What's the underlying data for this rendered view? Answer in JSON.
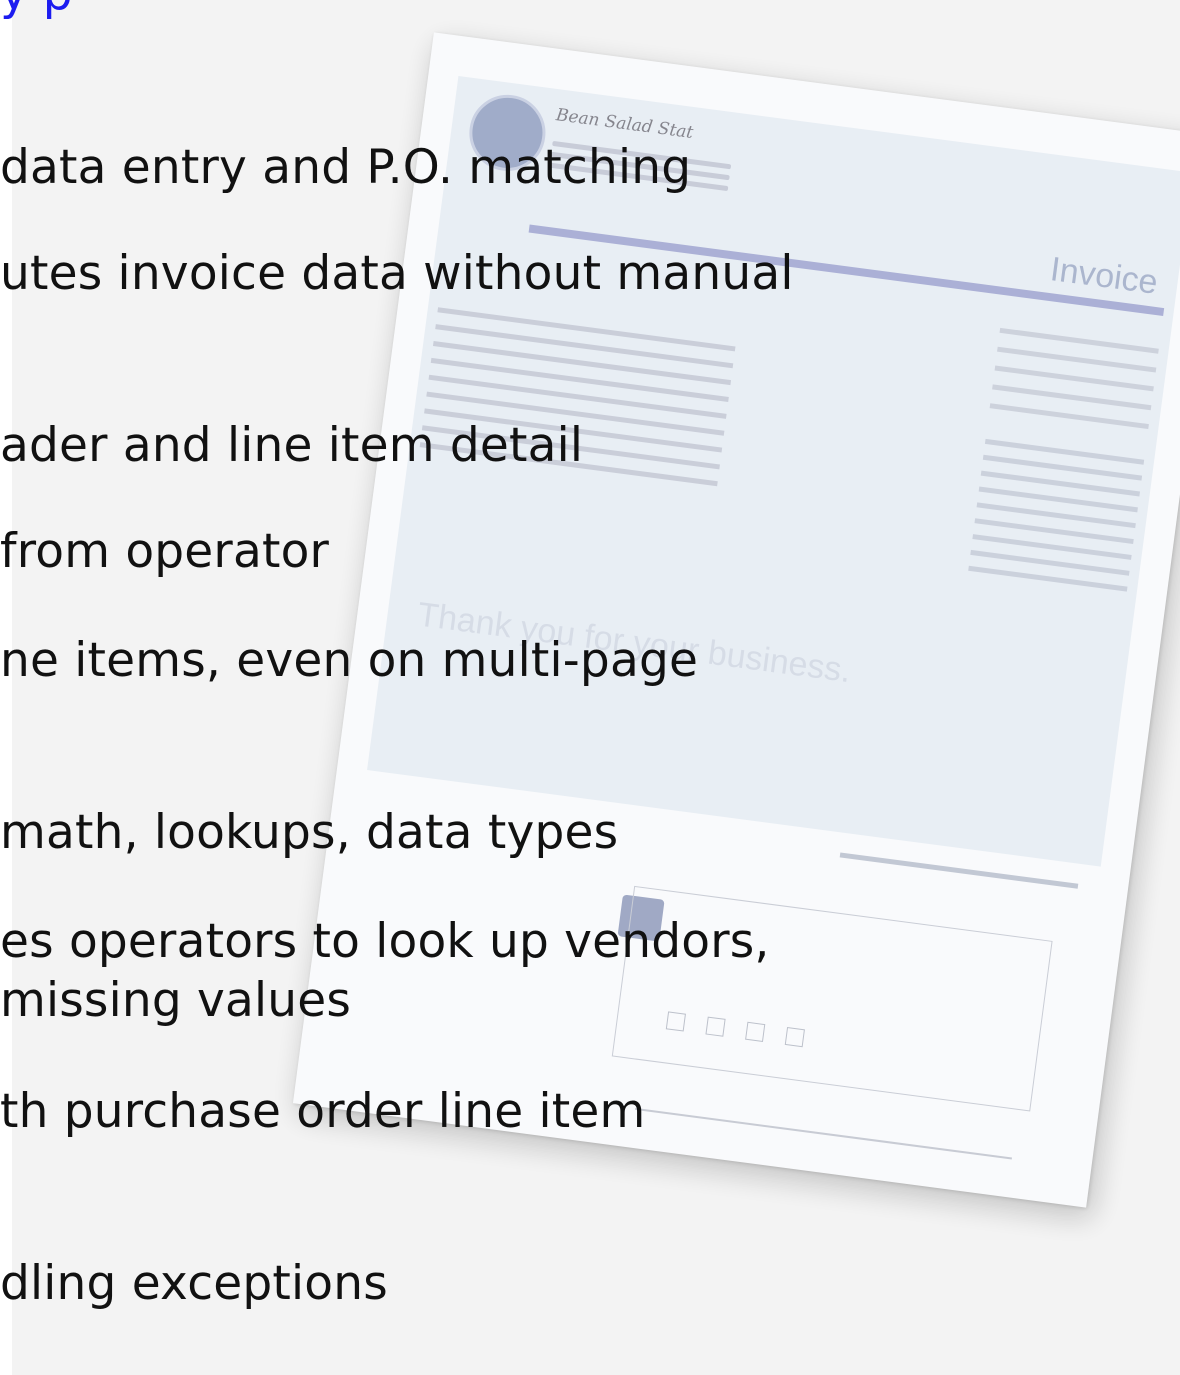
{
  "heading": "y        p",
  "lines": [
    "data entry and P.O. matching",
    "utes invoice data without manual",
    "ader and line item detail",
    "from operator",
    "ne items, even on multi-page",
    "math, lookups, data types",
    "es operators to look up vendors,",
    "missing values",
    "th purchase order line item",
    "dling exceptions"
  ],
  "invoice": {
    "company": "Bean Salad Stat",
    "title": "Invoice",
    "thanks": "Thank you for your business."
  }
}
